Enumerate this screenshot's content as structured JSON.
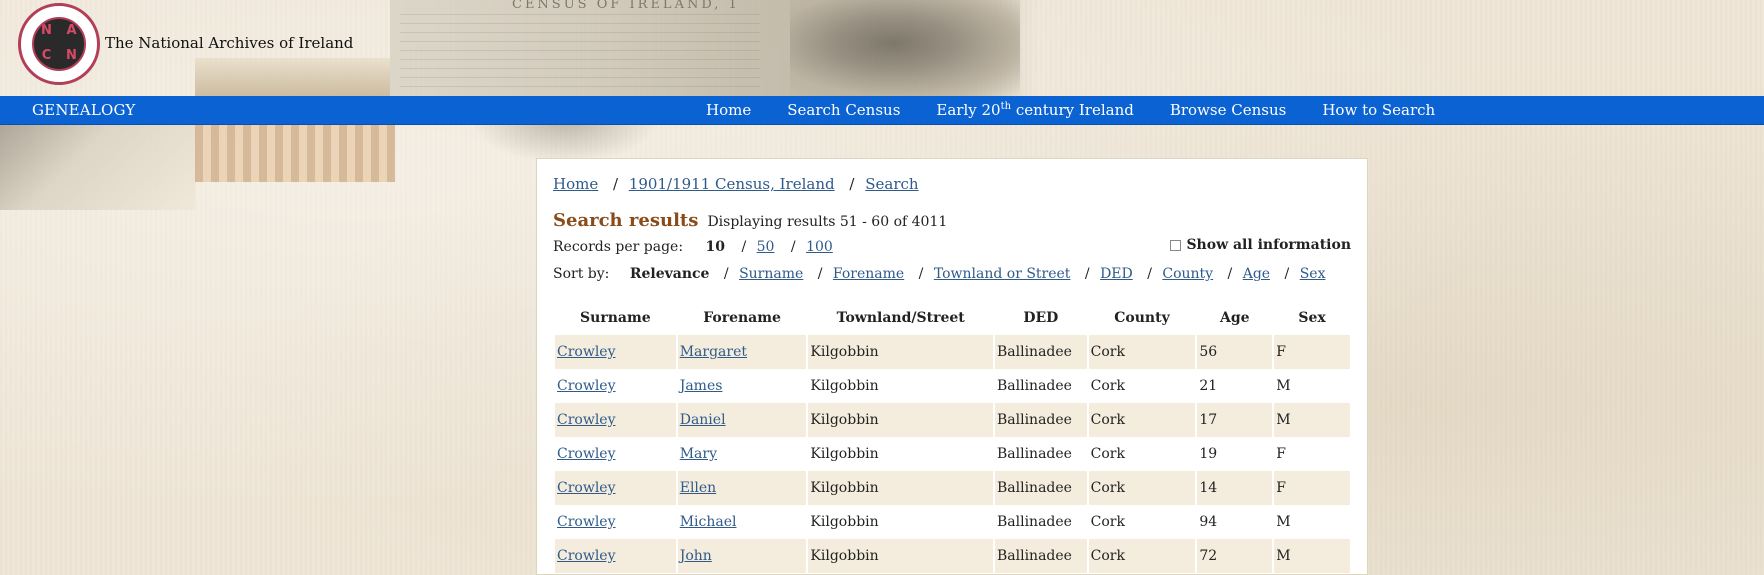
{
  "site": {
    "logo_alt": "National Archives An Chartlann Náisiúnta",
    "logo_letters": [
      "N",
      "A",
      "C",
      "N"
    ],
    "name": "The National Archives of Ireland",
    "header_doc_title": "CENSUS OF IRELAND, 1"
  },
  "nav": {
    "brand": "GENEALOGY",
    "items": [
      {
        "label": "Home"
      },
      {
        "label": "Search Census"
      },
      {
        "label_pre": "Early 20",
        "label_sup": "th",
        "label_post": " century Ireland"
      },
      {
        "label": "Browse Census"
      },
      {
        "label": "How to Search"
      }
    ]
  },
  "breadcrumb": [
    "Home",
    "1901/1911 Census, Ireland",
    "Search"
  ],
  "results": {
    "title": "Search results",
    "summary": "Displaying results 51 - 60 of 4011"
  },
  "records_per_page": {
    "label": "Records per page:",
    "current": "10",
    "options": [
      "50",
      "100"
    ]
  },
  "show_all": {
    "label": "Show all information",
    "checked": false
  },
  "sort_by": {
    "label": "Sort by:",
    "current": "Relevance",
    "options": [
      "Surname",
      "Forename",
      "Townland or Street",
      "DED",
      "County",
      "Age",
      "Sex"
    ]
  },
  "table": {
    "columns": [
      "Surname",
      "Forename",
      "Townland/Street",
      "DED",
      "County",
      "Age",
      "Sex"
    ],
    "rows": [
      [
        "Crowley",
        "Margaret",
        "Kilgobbin",
        "Ballinadee",
        "Cork",
        "56",
        "F"
      ],
      [
        "Crowley",
        "James",
        "Kilgobbin",
        "Ballinadee",
        "Cork",
        "21",
        "M"
      ],
      [
        "Crowley",
        "Daniel",
        "Kilgobbin",
        "Ballinadee",
        "Cork",
        "17",
        "M"
      ],
      [
        "Crowley",
        "Mary",
        "Kilgobbin",
        "Ballinadee",
        "Cork",
        "19",
        "F"
      ],
      [
        "Crowley",
        "Ellen",
        "Kilgobbin",
        "Ballinadee",
        "Cork",
        "14",
        "F"
      ],
      [
        "Crowley",
        "Michael",
        "Kilgobbin",
        "Ballinadee",
        "Cork",
        "94",
        "M"
      ],
      [
        "Crowley",
        "John",
        "Kilgobbin",
        "Ballinadee",
        "Cork",
        "72",
        "M"
      ]
    ]
  },
  "colors": {
    "nav_bg": "#0a62d3",
    "link": "#2f5a8a",
    "results_title": "#8a4b18",
    "row_stripe": "#f4eddd",
    "seal_red": "#b23e57"
  }
}
